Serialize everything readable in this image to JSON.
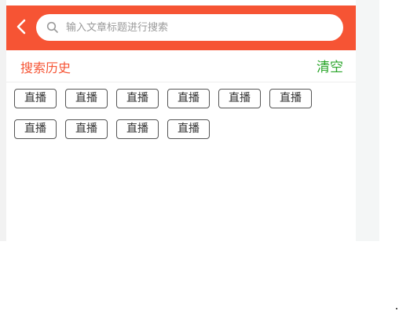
{
  "search": {
    "placeholder": "输入文章标题进行搜索",
    "value": ""
  },
  "history": {
    "title": "搜索历史",
    "clear_label": "清空",
    "tags": [
      "直播",
      "直播",
      "直播",
      "直播",
      "直播",
      "直播",
      "直播",
      "直播",
      "直播",
      "直播"
    ]
  },
  "colors": {
    "accent": "#f65434",
    "clear": "#2aa52a"
  },
  "icons": {
    "back": "chevron-left-icon",
    "search": "search-icon"
  }
}
